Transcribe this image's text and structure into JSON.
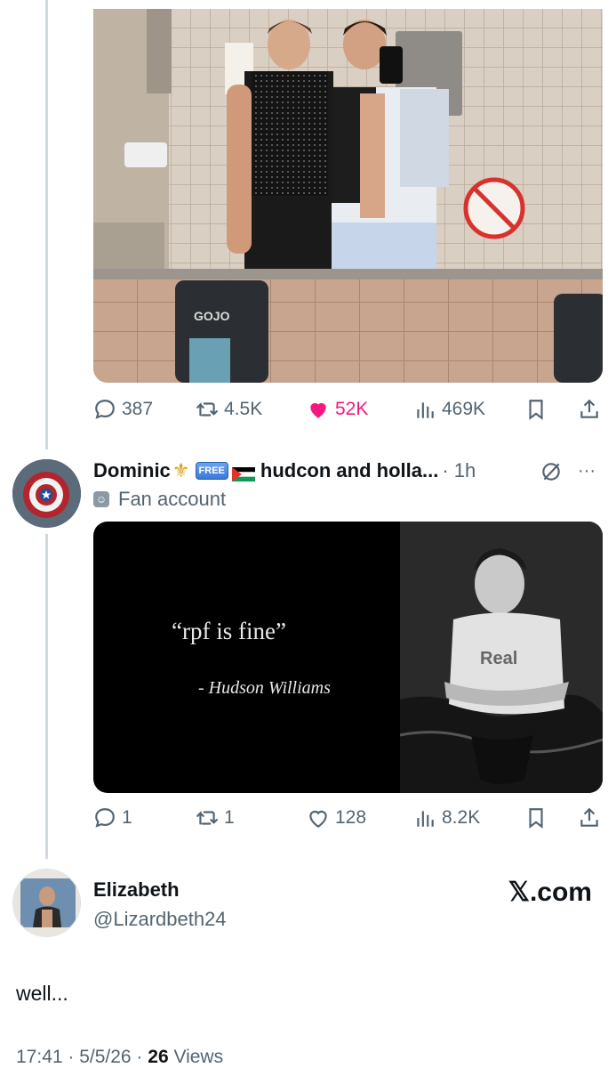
{
  "tweet1": {
    "actions": {
      "replies": "387",
      "retweets": "4.5K",
      "likes": "52K",
      "views": "469K"
    }
  },
  "tweet2": {
    "display_name": "Dominic",
    "free_badge": "FREE",
    "name_suffix": "hudcon and holla...",
    "time": "· 1h",
    "label": "Fan account",
    "quote_text": "“rpf is fine”",
    "quote_author": "- Hudson Williams",
    "shirt_text": "Real",
    "actions": {
      "replies": "1",
      "retweets": "1",
      "likes": "128",
      "views": "8.2K"
    }
  },
  "tweet3": {
    "display_name": "Elizabeth",
    "handle": "@Lizardbeth24",
    "brand": "𝕏.com",
    "text": "well...",
    "time": "17:41 · 5/5/26 · ",
    "views_count": "26",
    "views_label": " Views"
  },
  "colors": {
    "like_pink": "#f91880",
    "secondary_text": "#536471",
    "thread_line": "#cfd9de"
  },
  "icons": [
    "reply-icon",
    "retweet-icon",
    "heart-icon",
    "views-icon",
    "bookmark-icon",
    "share-icon",
    "grok-icon",
    "more-icon",
    "fleur-de-lis-icon",
    "palestine-flag-icon",
    "mask-icon"
  ]
}
